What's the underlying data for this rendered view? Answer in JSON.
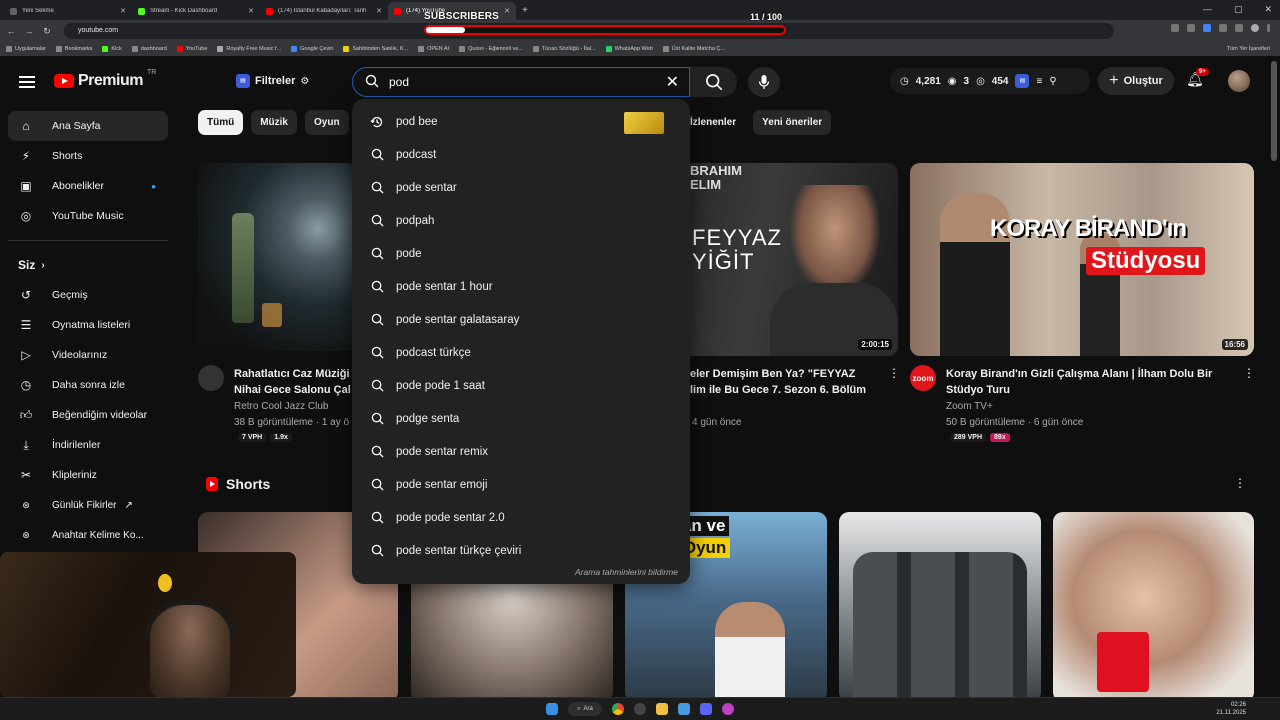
{
  "browser": {
    "tabs": [
      {
        "title": "Yeni Sekme",
        "color": "#5f6368"
      },
      {
        "title": "Stream - Kick Dashboard",
        "color": "#53fc18"
      },
      {
        "title": "(174) İstanbul Kabadayıları: Tarih",
        "color": "#ff0000"
      },
      {
        "title": "(174) YouTube",
        "color": "#ff0000"
      }
    ],
    "url": "youtube.com",
    "bookmarks": [
      "Uygulamalar",
      "Bookmarks",
      "Kick",
      "dashboard",
      "YouTube",
      "Royalty Free Music f...",
      "Google Çeviri",
      "Sahibinden Satılık, K...",
      "OPEN AI",
      "Quizei - Eğlenceli ve...",
      "Tüoan Sözlüğü - İtal...",
      "WhatsApp Web",
      "Üst Kalite Matcha Ç..."
    ],
    "bookmarks_right": "Tüm Yer İşaretleri"
  },
  "overlay": {
    "label": "SUBSCRIBERS",
    "count": "11  / 100",
    "progress": 0.11
  },
  "header": {
    "logo": "Premium",
    "country": "TR",
    "filters": "Filtreler",
    "search_value": "pod",
    "stats": [
      "4,281",
      "3",
      "454"
    ],
    "create": "Oluştur",
    "notif_count": "9+"
  },
  "sidebar": {
    "items": [
      "Ana Sayfa",
      "Shorts",
      "Abonelikler",
      "YouTube Music"
    ],
    "section": "Siz",
    "you_items": [
      "Geçmiş",
      "Oynatma listeleri",
      "Videolarınız",
      "Daha sonra izle",
      "Beğendiğim videolar",
      "İndirilenler",
      "Klipleriniz",
      "Günlük Fikirler",
      "Anahtar Kelime Ko..."
    ]
  },
  "chips": [
    "Tümü",
    "Müzik",
    "Oyun"
  ],
  "chips_right": [
    "İzlenenler",
    "Yeni öneriler"
  ],
  "suggestions": [
    "pod bee",
    "podcast",
    "pode sentar",
    "podpah",
    "pode",
    "pode sentar 1 hour",
    "pode sentar galatasaray",
    "podcast türkçe",
    "pode pode 1 saat",
    "podge senta",
    "pode sentar remix",
    "pode sentar emoji",
    "pode pode sentar 2.0",
    "pode sentar türkçe çeviri"
  ],
  "report_text": "Arama tahminlerini bildirme",
  "videos": [
    {
      "title1": "Rahatlatıcı Caz Müziği",
      "title2": "Nihai Gece Salonu Çal",
      "channel": "Retro Cool Jazz Club",
      "meta": "38 B görüntüleme · 1 ay ö",
      "b1": "7 VPH",
      "b2": "1.9x"
    },
    {
      "title1": "eler Demişim Ben Ya? \"FEYYAZ",
      "title2": "lim ile Bu Gece 7. Sezon 6. Bölüm",
      "meta": "4 gün önce",
      "duration": "2:00:15",
      "thumb_line1": "BRAHIM",
      "thumb_line2": "ELIM",
      "thumb_line3": "FEYYAZ",
      "thumb_line4": "YİĞİT"
    },
    {
      "title1": "Koray Birand'ın Gizli Çalışma Alanı | İlham Dolu Bir",
      "title2": "Stüdyo Turu",
      "channel": "Zoom TV+",
      "meta": "50 B görüntüleme · 6 gün önce",
      "b1": "289 VPH",
      "b2": "89x",
      "duration": "16:56",
      "thumb_line1": "KORAY BİRAND'ın",
      "thumb_line2": "Stüdyosu",
      "avatar": "zoom"
    }
  ],
  "shorts": {
    "title": "Shorts",
    "caption1": "saklanan ve",
    "caption2": "latılan Oyun"
  },
  "taskbar": {
    "search": "Ara",
    "time": "02:26",
    "date": "21.11.2025"
  }
}
